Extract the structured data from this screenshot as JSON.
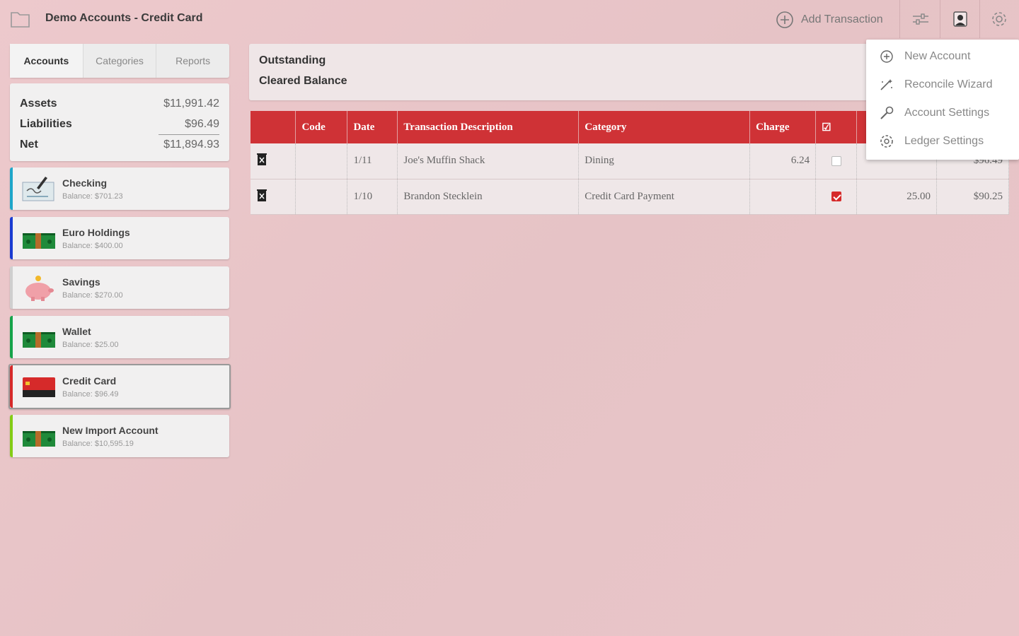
{
  "header": {
    "title": "Demo Accounts - Credit Card",
    "add_transaction_label": "Add Transaction"
  },
  "tabs": [
    "Accounts",
    "Categories",
    "Reports"
  ],
  "summary": {
    "assets_label": "Assets",
    "assets_value": "$11,991.42",
    "liabilities_label": "Liabilities",
    "liabilities_value": "$96.49",
    "net_label": "Net",
    "net_value": "$11,894.93"
  },
  "accounts": [
    {
      "name": "Checking",
      "balance": "Balance: $701.23",
      "icon": "checkbook-icon",
      "color": "#1fa6c9"
    },
    {
      "name": "Euro Holdings",
      "balance": "Balance: $400.00",
      "icon": "cash-icon",
      "color": "#1a3bd1"
    },
    {
      "name": "Savings",
      "balance": "Balance: $270.00",
      "icon": "piggy-bank-icon",
      "color": "#cfcfcf"
    },
    {
      "name": "Wallet",
      "balance": "Balance: $25.00",
      "icon": "cash-icon",
      "color": "#16a34a"
    },
    {
      "name": "Credit Card",
      "balance": "Balance: $96.49",
      "icon": "credit-card-icon",
      "color": "#d62a2a"
    },
    {
      "name": "New Import Account",
      "balance": "Balance: $10,595.19",
      "icon": "cash-icon",
      "color": "#84cc16"
    }
  ],
  "balance_panel": {
    "outstanding_label": "Outstanding",
    "cleared_label": "Cleared Balance"
  },
  "ledger": {
    "headers": [
      "",
      "Code",
      "Date",
      "Transaction Description",
      "Category",
      "Charge",
      "☑",
      "",
      ""
    ],
    "rows": [
      {
        "code": "",
        "date": "1/11",
        "description": "Joe's Muffin Shack",
        "category": "Dining",
        "charge": "6.24",
        "cleared": false,
        "payment": "",
        "balance": "$96.49"
      },
      {
        "code": "",
        "date": "1/10",
        "description": "Brandon Stecklein",
        "category": "Credit Card Payment",
        "charge": "",
        "cleared": true,
        "payment": "25.00",
        "balance": "$90.25"
      }
    ]
  },
  "menu": {
    "items": [
      {
        "label": "New Account",
        "icon": "plus-circle-icon"
      },
      {
        "label": "Reconcile Wizard",
        "icon": "wand-icon"
      },
      {
        "label": "Account Settings",
        "icon": "wrench-icon"
      },
      {
        "label": "Ledger Settings",
        "icon": "gear-icon"
      }
    ]
  },
  "colors": {
    "header_red": "#cf3236",
    "negative": "#e06a6a",
    "positive": "#7cc07a"
  }
}
